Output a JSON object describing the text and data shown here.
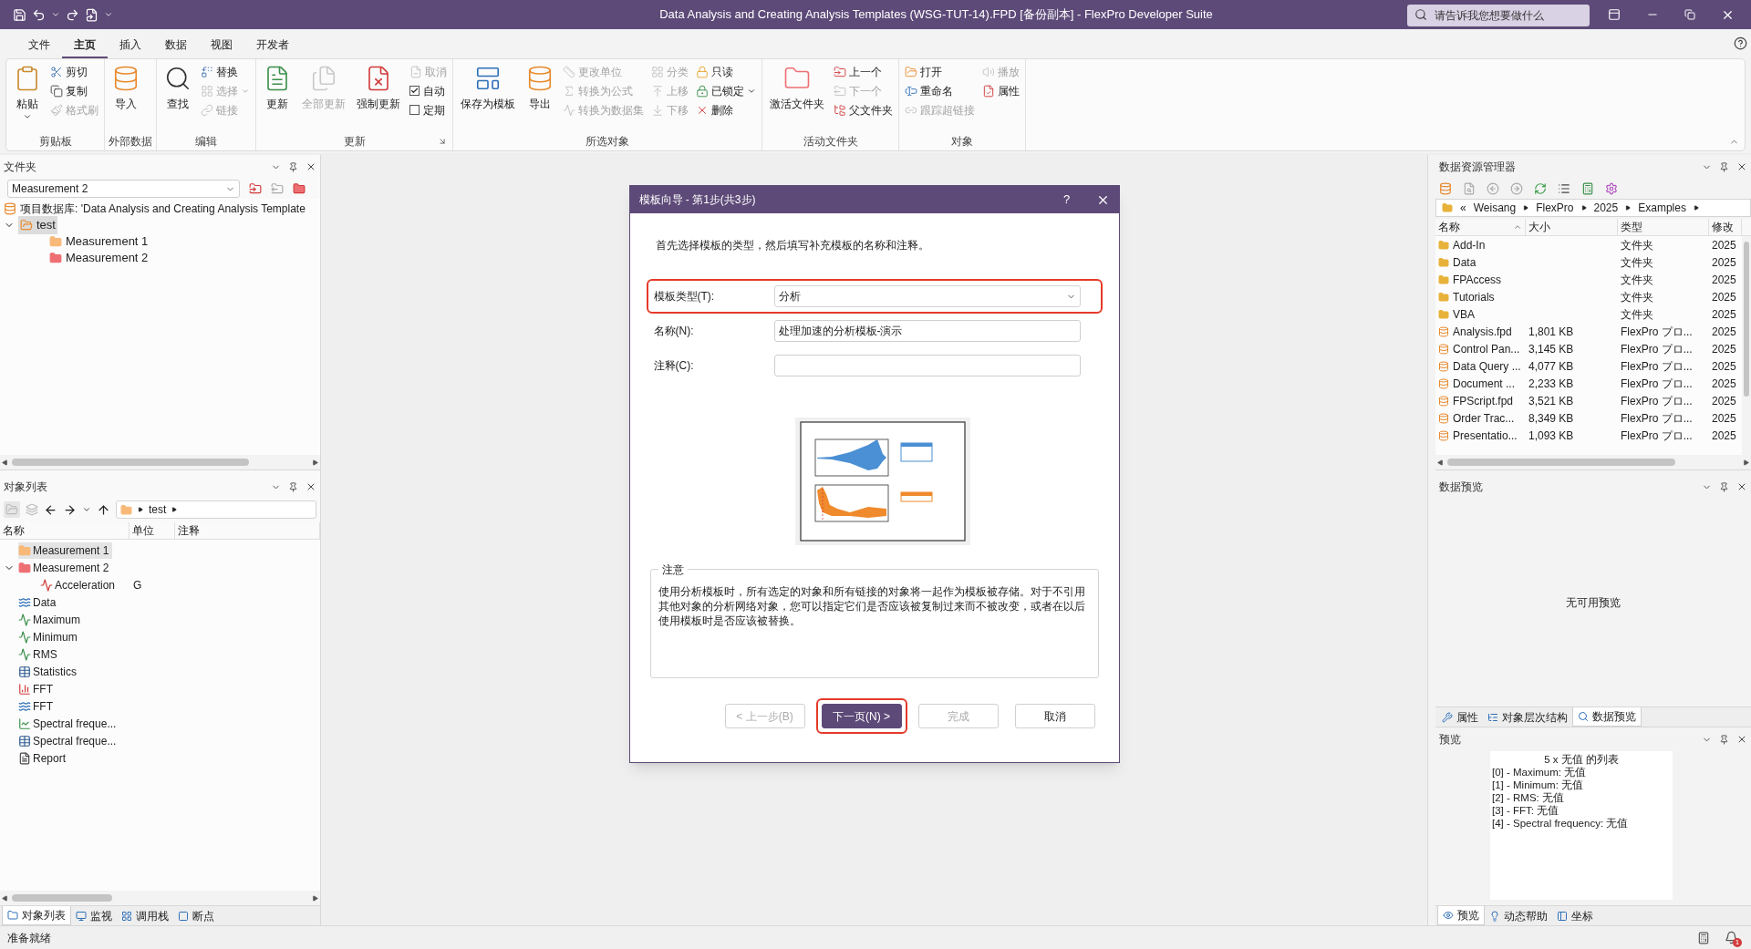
{
  "window": {
    "title": "Data Analysis and Creating Analysis Templates (WSG-TUT-14).FPD [备份副本] - FlexPro Developer Suite",
    "search_placeholder": "请告诉我您想要做什么"
  },
  "menu_tabs": [
    {
      "label": "文件",
      "selected": false
    },
    {
      "label": "主页",
      "selected": true
    },
    {
      "label": "插入",
      "selected": false
    },
    {
      "label": "数据",
      "selected": false
    },
    {
      "label": "视图",
      "selected": false
    },
    {
      "label": "开发者",
      "selected": false
    }
  ],
  "ribbon": {
    "groups": [
      {
        "label": "剪贴板",
        "columns": [
          [
            {
              "label": "粘贴",
              "kind": "large",
              "disabled": false,
              "dropdown": true
            }
          ],
          [
            {
              "label": "剪切",
              "kind": "small",
              "disabled": false
            },
            {
              "label": "复制",
              "kind": "small",
              "disabled": false
            },
            {
              "label": "格式刷",
              "kind": "small",
              "disabled": true
            }
          ]
        ]
      },
      {
        "label": "外部数据",
        "columns": [
          [
            {
              "label": "导入",
              "kind": "large",
              "disabled": false
            }
          ]
        ]
      },
      {
        "label": "编辑",
        "columns": [
          [
            {
              "label": "查找",
              "kind": "large",
              "disabled": false
            }
          ],
          [
            {
              "label": "替换",
              "kind": "small",
              "disabled": false
            },
            {
              "label": "选择",
              "kind": "small",
              "disabled": true,
              "dropdown": true
            },
            {
              "label": "链接",
              "kind": "small",
              "disabled": true
            }
          ]
        ]
      },
      {
        "label": "更新",
        "launcher": true,
        "columns": [
          [
            {
              "label": "更新",
              "kind": "large",
              "disabled": false
            }
          ],
          [
            {
              "label": "全部更新",
              "kind": "large",
              "disabled": true
            }
          ],
          [
            {
              "label": "强制更新",
              "kind": "large",
              "disabled": false
            }
          ],
          [
            {
              "label": "取消",
              "kind": "small",
              "disabled": true
            },
            {
              "label": "自动",
              "kind": "check",
              "checked": true
            },
            {
              "label": "定期",
              "kind": "check",
              "checked": false
            }
          ]
        ]
      },
      {
        "label": "所选对象",
        "columns": [
          [
            {
              "label": "保存为模板",
              "kind": "large",
              "disabled": false
            }
          ],
          [
            {
              "label": "导出",
              "kind": "large",
              "disabled": false
            }
          ],
          [
            {
              "label": "更改单位",
              "kind": "small",
              "disabled": true
            },
            {
              "label": "转换为公式",
              "kind": "small",
              "disabled": true
            },
            {
              "label": "转换为数据集",
              "kind": "small",
              "disabled": true
            }
          ],
          [
            {
              "label": "分类",
              "kind": "small",
              "disabled": true
            },
            {
              "label": "上移",
              "kind": "small",
              "disabled": true
            },
            {
              "label": "下移",
              "kind": "small",
              "disabled": true
            }
          ],
          [
            {
              "label": "只读",
              "kind": "small",
              "disabled": false
            },
            {
              "label": "已锁定",
              "kind": "small",
              "disabled": false,
              "dropdown": true
            },
            {
              "label": "删除",
              "kind": "small",
              "disabled": false
            }
          ]
        ]
      },
      {
        "label": "活动文件夹",
        "columns": [
          [
            {
              "label": "激活文件夹",
              "kind": "large",
              "disabled": false
            }
          ],
          [
            {
              "label": "上一个",
              "kind": "small",
              "disabled": false
            },
            {
              "label": "下一个",
              "kind": "small",
              "disabled": true
            },
            {
              "label": "父文件夹",
              "kind": "small",
              "disabled": false
            }
          ]
        ]
      },
      {
        "label": "对象",
        "columns": [
          [
            {
              "label": "打开",
              "kind": "small",
              "disabled": false
            },
            {
              "label": "重命名",
              "kind": "small",
              "disabled": false
            },
            {
              "label": "跟踪超链接",
              "kind": "small",
              "disabled": true
            }
          ],
          [
            {
              "label": "播放",
              "kind": "small",
              "disabled": true
            },
            {
              "label": "属性",
              "kind": "small",
              "disabled": false
            }
          ]
        ]
      }
    ]
  },
  "folder_panel": {
    "title": "文件夹",
    "combo": "Measurement 2",
    "database": "项目数据库: 'Data Analysis and Creating Analysis Template",
    "tree": [
      {
        "label": "test",
        "expanded": true,
        "selected": true,
        "children": [
          {
            "label": "Measurement 1",
            "color": "#f8b878"
          },
          {
            "label": "Measurement 2",
            "color": "#ee6f73"
          }
        ]
      }
    ]
  },
  "object_panel": {
    "title": "对象列表",
    "path": "test",
    "columns": [
      "名称",
      "单位",
      "注释"
    ],
    "rows": [
      {
        "label": "Measurement 1",
        "kind": "folder",
        "color": "#f8b878",
        "selected": true
      },
      {
        "label": "Measurement 2",
        "kind": "folder",
        "color": "#ee6f73",
        "selected": false,
        "expanded": true,
        "children": [
          {
            "label": "Acceleration",
            "kind": "signal",
            "unit": "G",
            "selected": false
          }
        ]
      },
      {
        "label": "Data",
        "kind": "series",
        "selected": false
      },
      {
        "label": "Maximum",
        "kind": "formula",
        "selected": false
      },
      {
        "label": "Minimum",
        "kind": "formula",
        "selected": false
      },
      {
        "label": "RMS",
        "kind": "formula",
        "selected": false
      },
      {
        "label": "Statistics",
        "kind": "table",
        "selected": false
      },
      {
        "label": "FFT",
        "kind": "spectrum",
        "selected": false
      },
      {
        "label": "FFT",
        "kind": "series",
        "selected": false
      },
      {
        "label": "Spectral freque...",
        "kind": "diagram",
        "selected": false
      },
      {
        "label": "Spectral freque...",
        "kind": "table",
        "selected": false
      },
      {
        "label": "Report",
        "kind": "document",
        "selected": false
      }
    ],
    "tabs": [
      {
        "label": "对象列表",
        "selected": true
      },
      {
        "label": "监视",
        "selected": false
      },
      {
        "label": "调用栈",
        "selected": false
      },
      {
        "label": "断点",
        "selected": false
      }
    ]
  },
  "dialog": {
    "title": "模板向导 - 第1步(共3步)",
    "help": "?",
    "intro": "首先选择模板的类型，然后填写补充模板的名称和注释。",
    "fields": [
      {
        "label": "模板类型(T):",
        "kind": "select",
        "value": "分析",
        "highlighted": true
      },
      {
        "label": "名称(N):",
        "kind": "text",
        "value": "处理加速的分析模板-演示",
        "highlighted": false
      },
      {
        "label": "注释(C):",
        "kind": "text",
        "highlighted": false
      }
    ],
    "note": {
      "title": "注意",
      "text": "使用分析模板时，所有选定的对象和所有链接的对象将一起作为模板被存储。对于不引用其他对象的分析网络对象，您可以指定它们是否应该被复制过来而不被改变，或者在以后使用模板时是否应该被替换。"
    },
    "buttons": [
      {
        "label": "< 上一步(B)",
        "disabled": true,
        "primary": false,
        "highlighted": false
      },
      {
        "label": "下一页(N) >",
        "disabled": false,
        "primary": true,
        "highlighted": true
      },
      {
        "label": "完成",
        "disabled": true,
        "primary": false,
        "highlighted": false
      },
      {
        "label": "取消",
        "disabled": false,
        "primary": false,
        "highlighted": false
      }
    ]
  },
  "explorer": {
    "title": "数据资源管理器",
    "path": [
      "«",
      "Weisang",
      "FlexPro",
      "2025",
      "Examples"
    ],
    "columns": [
      "名称",
      "大小",
      "类型",
      "修改"
    ],
    "rows": [
      {
        "kind": "folder",
        "name": "Add-In",
        "type": "文件夹",
        "date": "2025"
      },
      {
        "kind": "folder",
        "name": "Data",
        "type": "文件夹",
        "date": "2025"
      },
      {
        "kind": "folder",
        "name": "FPAccess",
        "type": "文件夹",
        "date": "2025"
      },
      {
        "kind": "folder",
        "name": "Tutorials",
        "type": "文件夹",
        "date": "2025"
      },
      {
        "kind": "folder",
        "name": "VBA",
        "type": "文件夹",
        "date": "2025"
      },
      {
        "kind": "file",
        "name": "Analysis.fpd",
        "size": "1,801 KB",
        "type": "FlexPro プロ...",
        "date": "2025"
      },
      {
        "kind": "file",
        "name": "Control Pan...",
        "size": "3,145 KB",
        "type": "FlexPro プロ...",
        "date": "2025"
      },
      {
        "kind": "file",
        "name": "Data Query ...",
        "size": "4,077 KB",
        "type": "FlexPro プロ...",
        "date": "2025"
      },
      {
        "kind": "file",
        "name": "Document ...",
        "size": "2,233 KB",
        "type": "FlexPro プロ...",
        "date": "2025"
      },
      {
        "kind": "file",
        "name": "FPScript.fpd",
        "size": "3,521 KB",
        "type": "FlexPro プロ...",
        "date": "2025"
      },
      {
        "kind": "file",
        "name": "Order Trac...",
        "size": "8,349 KB",
        "type": "FlexPro プロ...",
        "date": "2025"
      },
      {
        "kind": "file",
        "name": "Presentatio...",
        "size": "1,093 KB",
        "type": "FlexPro プロ...",
        "date": "2025"
      }
    ]
  },
  "data_preview": {
    "title": "数据预览",
    "message": "无可用预览",
    "tabs": [
      {
        "label": "属性",
        "selected": false
      },
      {
        "label": "对象层次结构",
        "selected": false
      },
      {
        "label": "数据预览",
        "selected": true
      }
    ]
  },
  "preview": {
    "title": "预览",
    "heading": "5 x 无值 的列表",
    "lines": [
      "[0] - Maximum: 无值",
      "[1] - Minimum: 无值",
      "[2] - RMS: 无值",
      "[3] - FFT: 无值",
      "[4] - Spectral frequency: 无值"
    ],
    "tabs": [
      {
        "label": "预览",
        "selected": true
      },
      {
        "label": "动态帮助",
        "selected": false
      },
      {
        "label": "坐标",
        "selected": false
      }
    ]
  },
  "status_bar": {
    "text": "准备就绪",
    "notifications": "1"
  }
}
